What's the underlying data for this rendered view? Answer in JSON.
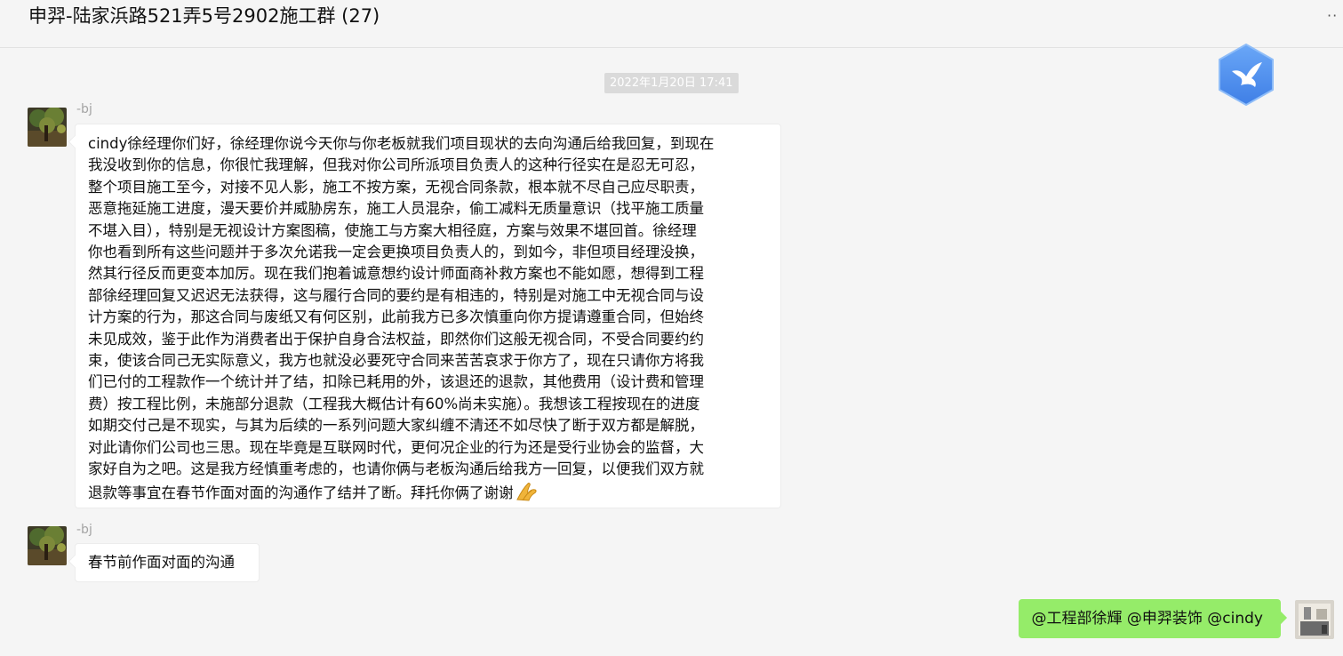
{
  "window": {
    "title": "申羿-陆家浜路521弄5号2902施工群 (27)",
    "more_label": "··"
  },
  "chat": {
    "timestamp": "2022年1月20日 17:41",
    "messages": [
      {
        "sender": "-bj",
        "lines": [
          "cindy徐经理你们好，徐经理你说今天你与你老板就我们项目现状的去向沟通后给我回复，到现在",
          "我没收到你的信息，你很忙我理解，但我对你公司所派项目负责人的这种行径实在是忍无可忍，",
          "整个项目施工至今，对接不见人影，施工不按方案，无视合同条款，根本就不尽自己应尽职责，",
          "恶意拖延施工进度，漫天要价并威胁房东，施工人员混杂，偷工减料无质量意识（找平施工质量",
          "不堪入目），特别是无视设计方案图稿，使施工与方案大相径庭，方案与效果不堪回首。徐经理",
          "你也看到所有这些问题并于多次允诺我一定会更换项目负责人的，到如今，非但项目经理没换，",
          "然其行径反而更变本加厉。现在我们抱着诚意想约设计师面商补救方案也不能如愿，想得到工程",
          "部徐经理回复又迟迟无法获得，这与履行合同的要约是有相违的，特别是对施工中无视合同与设",
          "计方案的行为，那这合同与废纸又有何区别，此前我方已多次慎重向你方提请遵重合同，但始终",
          "未见成效，鉴于此作为消费者出于保护自身合法权益，即然你们这般无视合同，不受合同要约约",
          "束，使该合同己无实际意义，我方也就没必要死守合同来苦苦哀求于你方了，现在只请你方将我",
          "们已付的工程款作一个统计并了结，扣除已耗用的外，该退还的退款，其他费用（设计费和管理",
          "费）按工程比例，未施部分退款（工程我大概估计有60%尚未实施）。我想该工程按现在的进度",
          "如期交付己是不现实，与其为后续的一系列问题大家纠缠不清还不如尽快了断于双方都是解脱，",
          "对此请你们公司也三思。现在毕竟是互联网时代，更何况企业的行为还是受行业协会的监督，大",
          "家好自为之吧。这是我方经慎重考虑的，也请你俩与老板沟通后给我方一回复，以便我们双方就",
          "退款等事宜在春节作面对面的沟通作了结并了断。拜托你俩了谢谢"
        ]
      },
      {
        "sender": "-bj",
        "text": "春节前作面对面的沟通"
      }
    ],
    "my_message": {
      "text": "@工程部徐輝 @申羿装饰 @cindy"
    }
  },
  "colors": {
    "background": "#f5f5f5",
    "my_bubble": "#95ec69",
    "other_bubble": "#ffffff",
    "timestamp_bg": "#dadada",
    "logo_blue": "#4c8ef0"
  },
  "icons": {
    "logo": "bird-logo-icon",
    "emoji": "praying-hands-emoji-icon",
    "more": "more-icon"
  }
}
